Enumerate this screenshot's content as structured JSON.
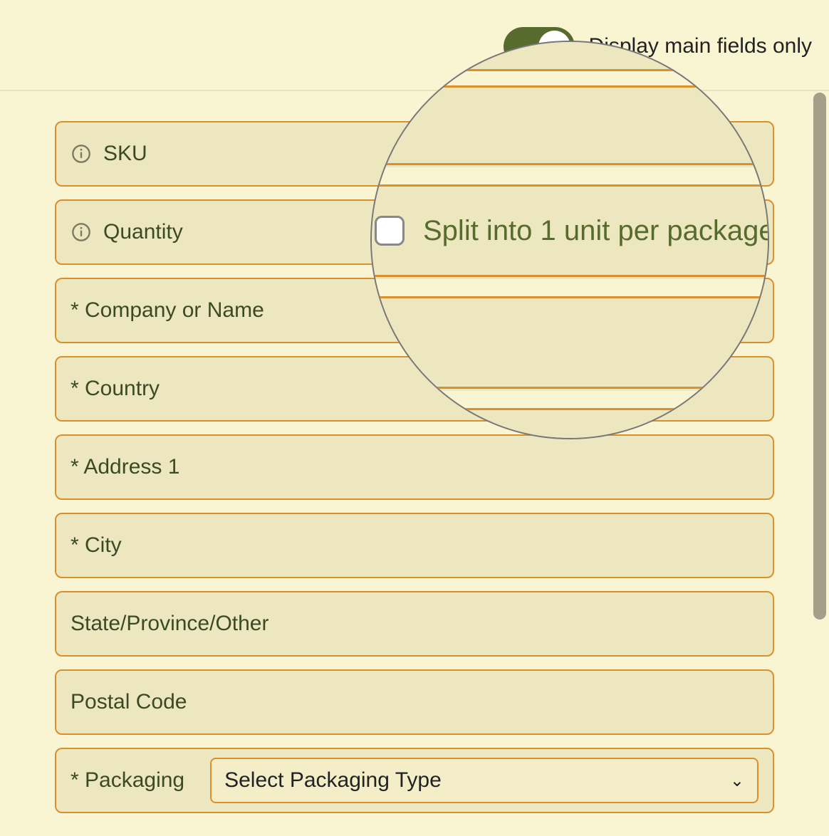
{
  "toggle": {
    "label": "Display main fields only",
    "on": true
  },
  "fields": {
    "sku": "SKU",
    "quantity": "Quantity",
    "company": "* Company or Name",
    "country": "* Country",
    "address1": "* Address 1",
    "city": "* City",
    "state": "State/Province/Other",
    "postal": "Postal Code",
    "packaging_label": "* Packaging",
    "packaging_placeholder": "Select Packaging Type"
  },
  "magnifier": {
    "checkbox_label": "Split into 1 unit per package",
    "checked": false
  }
}
